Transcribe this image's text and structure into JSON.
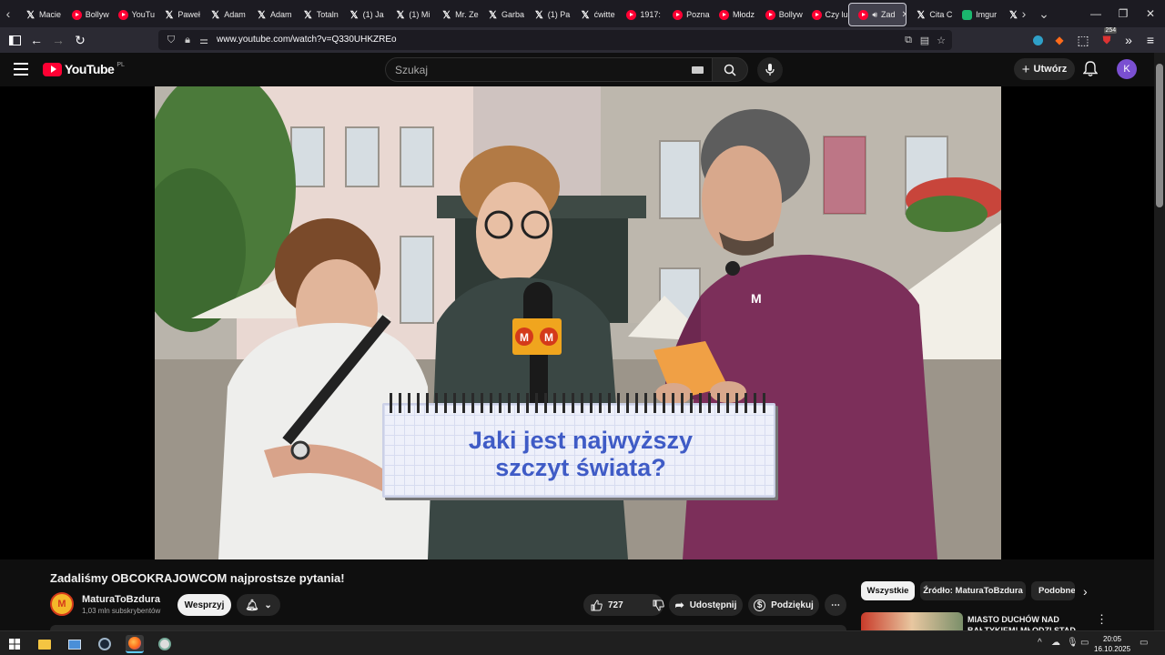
{
  "browser": {
    "tabs": [
      {
        "favicon": "x-icon",
        "label": "Macie"
      },
      {
        "favicon": "youtube-icon",
        "label": "Bollyw"
      },
      {
        "favicon": "youtube-icon",
        "label": "YouTu"
      },
      {
        "favicon": "x-icon",
        "label": "Paweł"
      },
      {
        "favicon": "x-icon",
        "label": "Adam"
      },
      {
        "favicon": "x-icon",
        "label": "Adam"
      },
      {
        "favicon": "x-icon",
        "label": "Totaln"
      },
      {
        "favicon": "x-icon",
        "label": "(1) Ja"
      },
      {
        "favicon": "x-icon",
        "label": "(1) Mi"
      },
      {
        "favicon": "x-icon",
        "label": "Mr. Ze"
      },
      {
        "favicon": "x-icon",
        "label": "Garba"
      },
      {
        "favicon": "x-icon",
        "label": "(1) Pa"
      },
      {
        "favicon": "x-icon",
        "label": "ćwitte"
      },
      {
        "favicon": "youtube-icon",
        "label": "1917:"
      },
      {
        "favicon": "youtube-icon",
        "label": "Pozna"
      },
      {
        "favicon": "youtube-icon",
        "label": "Młodz"
      },
      {
        "favicon": "youtube-icon",
        "label": "Bollyw"
      },
      {
        "favicon": "youtube-icon",
        "label": "Czy lu"
      },
      {
        "favicon": "youtube-icon",
        "label": "Zad",
        "active": true
      },
      {
        "favicon": "x-icon",
        "label": "Cita C"
      },
      {
        "favicon": "imgur-icon",
        "label": "Imgur"
      },
      {
        "favicon": "x-icon",
        "label": ""
      }
    ],
    "url": "www.youtube.com/watch?v=Q330UHKZREo",
    "extension_badge": "254"
  },
  "youtube": {
    "logo_text": "YouTube",
    "country_code": "PL",
    "search_placeholder": "Szukaj",
    "create_label": "Utwórz",
    "avatar_letter": "K"
  },
  "video": {
    "overlay_line1": "Jaki jest najwyższy",
    "overlay_line2": "szczyt świata?",
    "mic_logo": "M M",
    "shirt_logo": "M"
  },
  "details": {
    "title": "Zadaliśmy OBCOKRAJOWCOM najprostsze pytania!",
    "channel_name": "MaturaToBzdura",
    "channel_avatar_letter": "M",
    "subscribers": "1,03 mln subskrybentów",
    "support_label": "Wesprzyj",
    "likes": "727",
    "share_label": "Udostępnij",
    "thanks_label": "Podziękuj"
  },
  "recommendations": {
    "chips": [
      "Wszystkie",
      "Źródło: MaturaToBzdura",
      "Podobne"
    ],
    "first_title": "MIASTO DUCHÓW NAD BAŁTYKIEM! MŁODZI STAD"
  },
  "taskbar": {
    "time": "20:05",
    "date": "16.10.2025"
  }
}
